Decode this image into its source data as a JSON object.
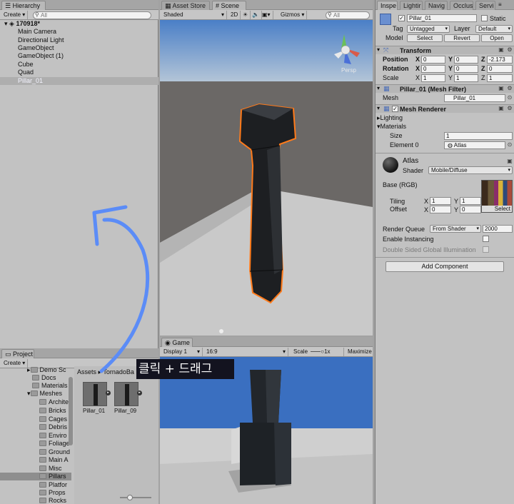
{
  "hierarchy": {
    "tab": "Hierarchy",
    "create_label": "Create",
    "search_placeholder": "All",
    "scene_name": "170918*",
    "items": [
      "Main Camera",
      "Directional Light",
      "GameObject",
      "GameObject (1)",
      "Cube",
      "Quad",
      "Pillar_01"
    ]
  },
  "scene": {
    "tabs": [
      "Asset Store",
      "Scene"
    ],
    "shading_mode": "Shaded",
    "mode_2d": "2D",
    "gizmos_label": "Gizmos",
    "search_placeholder": "All",
    "persp_label": "Persp"
  },
  "game": {
    "tab": "Game",
    "display": "Display 1",
    "aspect": "16:9",
    "scale_label": "Scale",
    "scale_value": "1x",
    "maximize_label": "Maximize"
  },
  "project": {
    "tab": "Project",
    "create_label": "Create",
    "folders": [
      "Demo Sc",
      "Docs",
      "Materials",
      "Meshes",
      "Archite",
      "Bricks",
      "Cages",
      "Debris",
      "Enviro",
      "Foliage",
      "Ground",
      "Main A",
      "Misc",
      "Pillars",
      "Platfor",
      "Props",
      "Rocks"
    ],
    "breadcrumb": [
      "Assets",
      "TornadoBa"
    ],
    "assets": [
      "Pillar_01",
      "Pillar_09"
    ]
  },
  "overlay": {
    "text": "클릭 + 드래그"
  },
  "inspector": {
    "tabs": [
      "Inspe",
      "Lightir",
      "Navig",
      "Occlus",
      "Servi"
    ],
    "object_name": "Pillar_01",
    "static_label": "Static",
    "tag_label": "Tag",
    "tag_value": "Untagged",
    "layer_label": "Layer",
    "layer_value": "Default",
    "model_label": "Model",
    "model_buttons": [
      "Select",
      "Revert",
      "Open"
    ],
    "transform": {
      "title": "Transform",
      "position_label": "Position",
      "rotation_label": "Rotation",
      "scale_label": "Scale",
      "position": {
        "x": "0",
        "y": "0",
        "z": "-2.173"
      },
      "rotation": {
        "x": "0",
        "y": "0",
        "z": "0"
      },
      "scale": {
        "x": "1",
        "y": "1",
        "z": "1"
      }
    },
    "mesh_filter": {
      "title": "Pillar_01 (Mesh Filter)",
      "mesh_label": "Mesh",
      "mesh_value": "Pillar_01"
    },
    "mesh_renderer": {
      "title": "Mesh Renderer",
      "lighting_label": "Lighting",
      "materials_label": "Materials",
      "size_label": "Size",
      "size_value": "1",
      "element_label": "Element 0",
      "element_value": "Atlas"
    },
    "material": {
      "name": "Atlas",
      "shader_label": "Shader",
      "shader_value": "Mobile/Diffuse",
      "base_label": "Base (RGB)",
      "tiling_label": "Tiling",
      "offset_label": "Offset",
      "tiling": {
        "x": "1",
        "y": "1"
      },
      "offset": {
        "x": "0",
        "y": "0"
      },
      "select_label": "Select",
      "render_queue_label": "Render Queue",
      "render_queue_mode": "From Shader",
      "render_queue_value": "2000",
      "instancing_label": "Enable Instancing",
      "double_sided_label": "Double Sided Global Illumination"
    },
    "add_component_label": "Add Component"
  },
  "colors": {
    "selection_outline": "#ff7a1a",
    "annotation_arrow": "#5b8cf7",
    "sky_top": "#3f79c7",
    "ground": "#6a6663"
  }
}
